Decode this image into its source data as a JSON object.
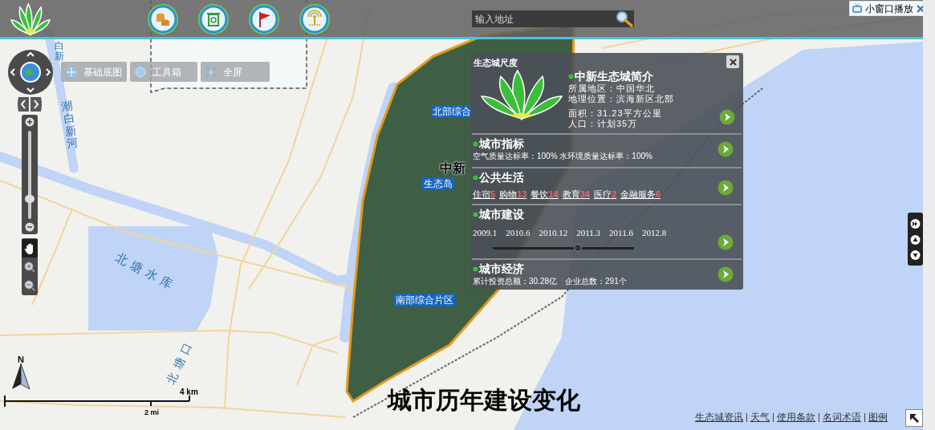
{
  "header": {
    "search": {
      "placeholder": "输入地址"
    },
    "mini_player": {
      "label": "小窗口播放"
    },
    "tools": [
      {
        "kind": "coins"
      },
      {
        "kind": "trash"
      },
      {
        "kind": "flag"
      },
      {
        "kind": "antenna"
      }
    ]
  },
  "map_toolbar": [
    {
      "kind": "basemap",
      "label": "基础底图"
    },
    {
      "kind": "toolbox",
      "label": "工具箱"
    },
    {
      "kind": "fullscreen",
      "label": "全屏"
    }
  ],
  "zoom_slider": {
    "level": 0.2
  },
  "map_tools": [
    {
      "kind": "pan",
      "selected": true
    },
    {
      "kind": "zoom-in",
      "selected": false
    },
    {
      "kind": "zoom-out",
      "selected": false
    }
  ],
  "map_labels": [
    {
      "text": "白新",
      "kind": "water-vertical"
    },
    {
      "text": "潮白新河",
      "kind": "water-vertical"
    },
    {
      "text": "北塘水库",
      "kind": "water"
    },
    {
      "text": "北塘口",
      "kind": "water"
    },
    {
      "text": "北部综合",
      "kind": "district"
    },
    {
      "text": "中新",
      "kind": "place"
    },
    {
      "text": "生态岛",
      "kind": "district"
    },
    {
      "text": "南部综合片区",
      "kind": "district"
    }
  ],
  "north_arrow": {
    "label": "N"
  },
  "scale_bar": {
    "km": "4 km",
    "mi": "2 mi"
  },
  "popup": {
    "title": "生态城尺度",
    "intro": {
      "title": "中新生态城简介",
      "lines": [
        "所属地区：中国华北",
        "地理位置：滨海新区北部",
        "面积：31.23平方公里",
        "人口：计划35万"
      ]
    },
    "sections": [
      {
        "kind": "text",
        "title": "城市指标",
        "text": "空气质量达标率：100% 水环境质量达标率：100%"
      },
      {
        "kind": "links",
        "title": "公共生活",
        "items": [
          {
            "label": "住宿",
            "count": "5"
          },
          {
            "label": "购物",
            "count": "13"
          },
          {
            "label": "餐饮",
            "count": "14"
          },
          {
            "label": "教育",
            "count": "34"
          },
          {
            "label": "医疗",
            "count": "2"
          },
          {
            "label": "金融服务",
            "count": "6"
          }
        ]
      },
      {
        "kind": "timeline",
        "title": "城市建设",
        "years": [
          "2009.1",
          "2010.6",
          "2010.12",
          "2011.3",
          "2011.6",
          "2012.8"
        ],
        "level": 0.6
      },
      {
        "kind": "text",
        "title": "城市经济",
        "text": "累计投资总额：30.28亿　企业总数：291个"
      }
    ]
  },
  "caption": "城市历年建设变化",
  "footer_links": [
    "生态城资讯",
    "天气",
    "使用条款",
    "名词术语",
    "图例"
  ]
}
